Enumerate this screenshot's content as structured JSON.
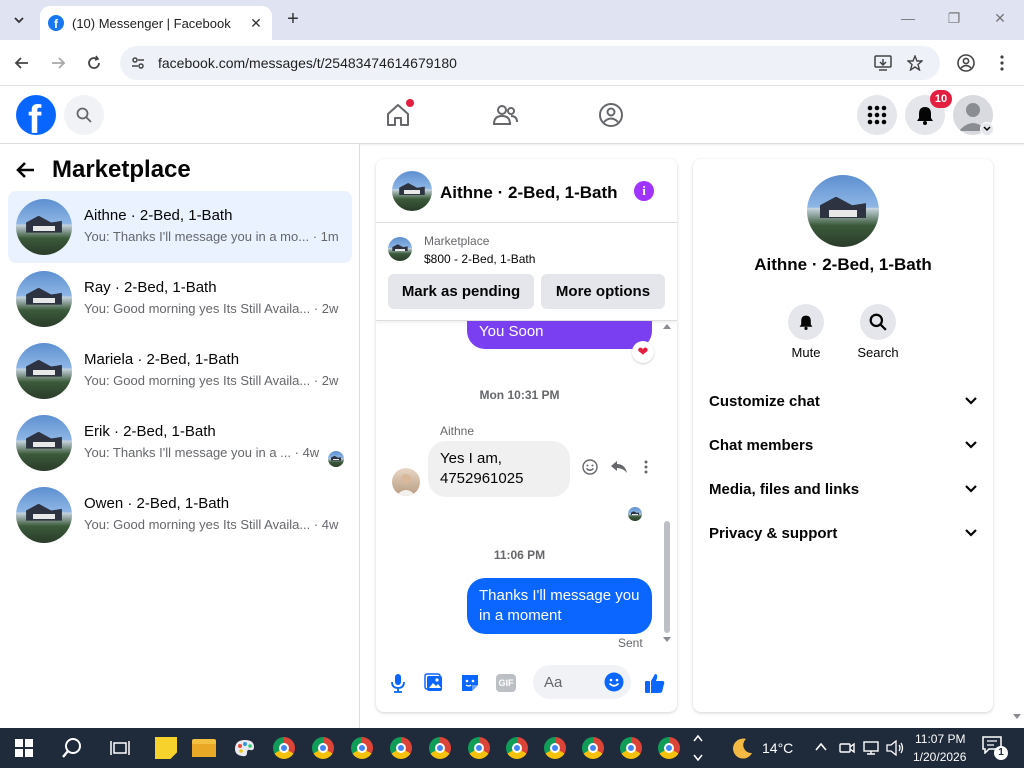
{
  "browser": {
    "tab_title": "(10) Messenger | Facebook",
    "url": "facebook.com/messages/t/25483474614679180"
  },
  "header": {
    "notifications_count": "10"
  },
  "sidebar": {
    "title": "Marketplace",
    "conversations": [
      {
        "name": "Aithne · 2-Bed, 1-Bath",
        "preview": "You: Thanks I'll message you in a mo...",
        "time": "· 1m",
        "active": true
      },
      {
        "name": "Ray · 2-Bed, 1-Bath",
        "preview": "You: Good morning yes Its Still Availa...",
        "time": "· 2w"
      },
      {
        "name": "Mariela · 2-Bed, 1-Bath",
        "preview": "You: Good morning yes Its Still Availa...",
        "time": "· 2w"
      },
      {
        "name": "Erik · 2-Bed, 1-Bath",
        "preview": "You: Thanks I'll message you in a ...",
        "time": "· 4w"
      },
      {
        "name": "Owen · 2-Bed, 1-Bath",
        "preview": "You: Good morning yes Its Still Availa...",
        "time": "· 4w"
      }
    ]
  },
  "chat": {
    "name": "Aithne · 2-Bed, 1-Bath",
    "marketplace_label": "Marketplace",
    "listing": "$800 - 2-Bed, 1-Bath",
    "mark_pending": "Mark as pending",
    "more_options": "More options",
    "messages": {
      "prev_out": "You Soon",
      "stamp1": "Mon 10:31 PM",
      "sender": "Aithne",
      "in_line1": "Yes I am,",
      "in_line2": "4752961025",
      "stamp2": "11:06 PM",
      "out_line1": "Thanks I'll message you",
      "out_line2": "in a moment",
      "status": "Sent"
    },
    "composer_placeholder": "Aa"
  },
  "info_panel": {
    "name": "Aithne · 2-Bed, 1-Bath",
    "mute_label": "Mute",
    "search_label": "Search",
    "sections": [
      "Customize chat",
      "Chat members",
      "Media, files and links",
      "Privacy & support"
    ]
  },
  "taskbar": {
    "weather": "14°C",
    "time": "11:07 PM",
    "date": "1/20/2026",
    "notif_count": "1"
  },
  "colors": {
    "fb_blue": "#0866ff",
    "messenger_blue": "#0a66ff",
    "purple": "#7b3ff2",
    "info_purple": "#a033ff"
  }
}
